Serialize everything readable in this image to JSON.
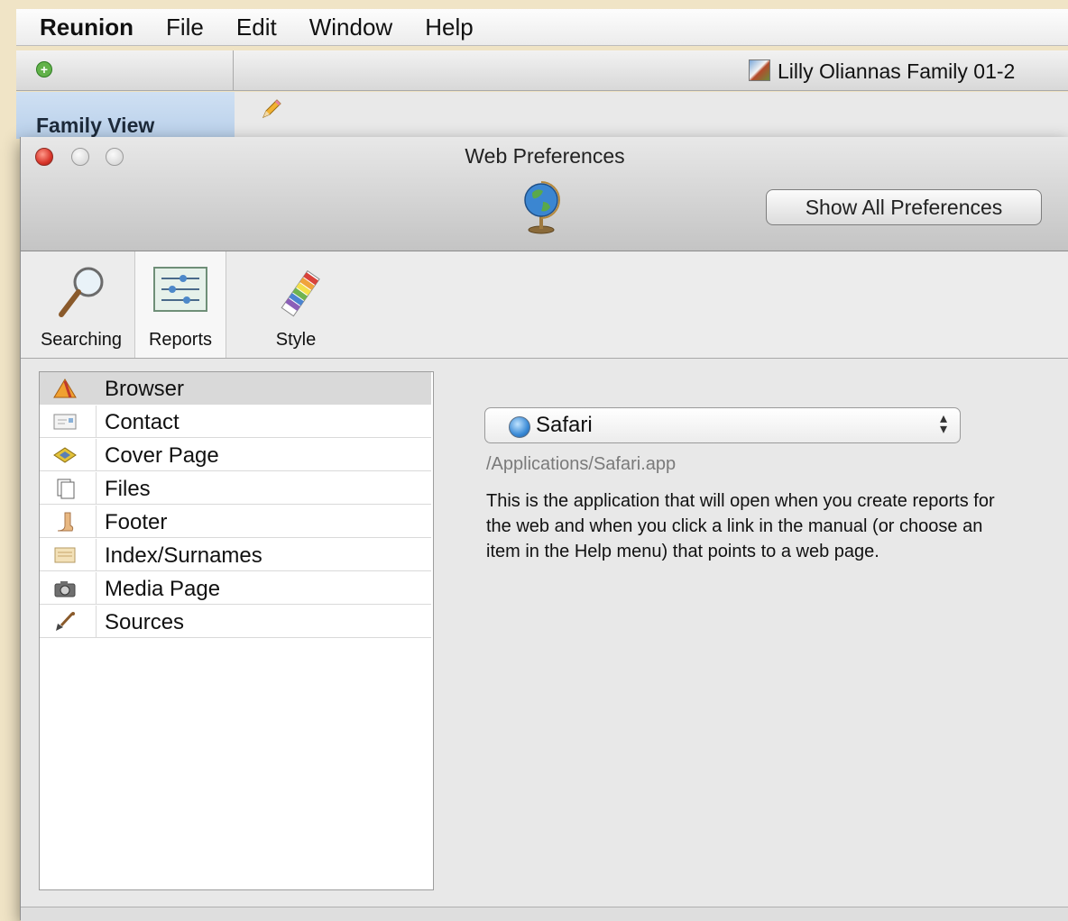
{
  "menubar": {
    "app": "Reunion",
    "items": [
      "File",
      "Edit",
      "Window",
      "Help"
    ]
  },
  "document": {
    "title": "Lilly Oliannas Family 01-2",
    "sidebar_title": "Family View"
  },
  "prefs": {
    "title": "Web Preferences",
    "show_all_label": "Show All Preferences",
    "tabs": [
      {
        "label": "Searching",
        "icon": "magnifier-icon"
      },
      {
        "label": "Reports",
        "icon": "sliders-icon"
      },
      {
        "label": "Style",
        "icon": "swatches-icon"
      }
    ],
    "active_tab": "Reports",
    "categories": [
      {
        "label": "Browser",
        "icon": "browser-icon",
        "selected": true
      },
      {
        "label": "Contact",
        "icon": "contact-card-icon"
      },
      {
        "label": "Cover Page",
        "icon": "cover-page-icon"
      },
      {
        "label": "Files",
        "icon": "files-icon"
      },
      {
        "label": "Footer",
        "icon": "footer-icon"
      },
      {
        "label": "Index/Surnames",
        "icon": "index-icon"
      },
      {
        "label": "Media Page",
        "icon": "camera-icon"
      },
      {
        "label": "Sources",
        "icon": "shovel-icon"
      }
    ],
    "browser": {
      "selected": "Safari",
      "path": "/Applications/Safari.app",
      "description": "This is the application that will open when you create reports for the web and when you click a link in the manual (or choose an item in the Help menu) that points to a web page."
    }
  },
  "colors": {
    "background": "#efe3c4",
    "selected_row": "#d9d9d9",
    "close_button": "#d8352a"
  }
}
